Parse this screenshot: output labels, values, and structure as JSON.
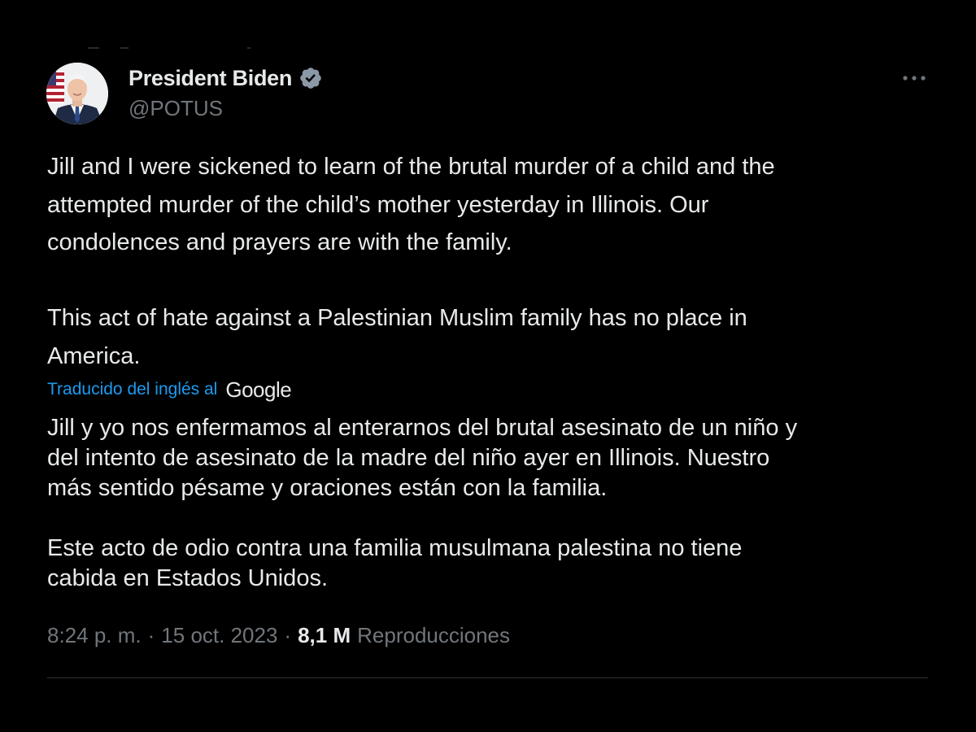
{
  "author": {
    "display_name": "President Biden",
    "handle": "@POTUS",
    "verified": true,
    "avatar": "avatar-photo"
  },
  "tweet": {
    "original_text": "Jill and I were sickened to learn of the brutal murder of a child and the\nattempted murder of the child’s mother yesterday in Illinois. Our\ncondolences and prayers are with the family.\n\nThis act of hate against a Palestinian Muslim family has no place in\nAmerica.",
    "translation_label": "Traducido del inglés al",
    "translation_provider": "Google",
    "translated_text": "Jill y yo nos enfermamos al enterarnos del brutal asesinato de un niño y\ndel intento de asesinato de la madre del niño ayer en Illinois. Nuestro\nmás sentido pésame y oraciones están con la familia.\n\nEste acto de odio contra una familia musulmana palestina no tiene\ncabida en Estados Unidos."
  },
  "meta": {
    "time": "8:24 p. m.",
    "date": "15 oct. 2023",
    "separator": "·",
    "views_count": "8,1 M",
    "views_label": "Reproducciones"
  },
  "icons": {
    "verified": "verified-badge-icon",
    "more": "more-options-icon"
  },
  "colors": {
    "background": "#000000",
    "text": "#e7e9ea",
    "secondary": "#71767b",
    "link": "#1d9bf0",
    "divider": "#2f3336"
  }
}
